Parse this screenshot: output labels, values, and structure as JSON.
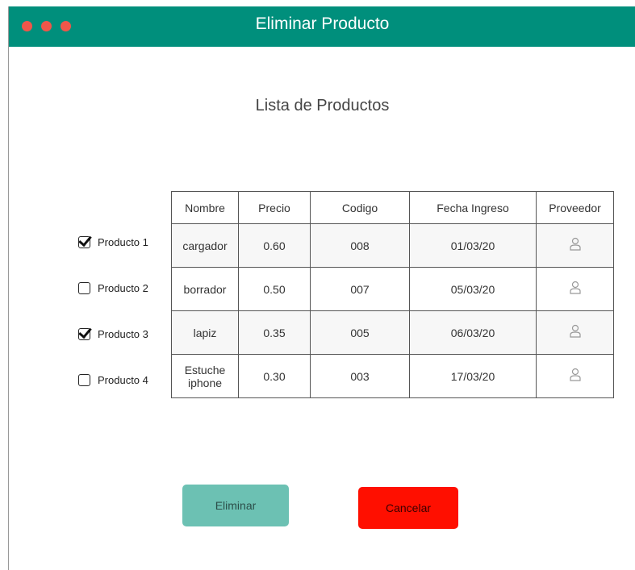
{
  "window": {
    "title": "Eliminar Producto"
  },
  "heading": "Lista de Productos",
  "checklist": [
    {
      "label": "Producto 1",
      "checked": true
    },
    {
      "label": "Producto 2",
      "checked": false
    },
    {
      "label": "Producto 3",
      "checked": true
    },
    {
      "label": "Producto 4",
      "checked": false
    }
  ],
  "table": {
    "headers": [
      "Nombre",
      "Precio",
      "Codigo",
      "Fecha Ingreso",
      "Proveedor"
    ],
    "rows": [
      {
        "nombre": "cargador",
        "precio": "0.60",
        "codigo": "008",
        "fecha": "01/03/20",
        "proveedor_icon": "person-icon"
      },
      {
        "nombre": "borrador",
        "precio": "0.50",
        "codigo": "007",
        "fecha": "05/03/20",
        "proveedor_icon": "person-icon"
      },
      {
        "nombre": "lapiz",
        "precio": "0.35",
        "codigo": "005",
        "fecha": "06/03/20",
        "proveedor_icon": "person-icon"
      },
      {
        "nombre": "Estuche iphone",
        "precio": "0.30",
        "codigo": "003",
        "fecha": "17/03/20",
        "proveedor_icon": "person-icon"
      }
    ]
  },
  "buttons": {
    "delete": "Eliminar",
    "cancel": "Cancelar"
  },
  "colors": {
    "titlebar": "#008f7c",
    "window_dots": "#f0564a",
    "delete_button": "#6cc1b3",
    "cancel_button": "#ff0f00"
  }
}
